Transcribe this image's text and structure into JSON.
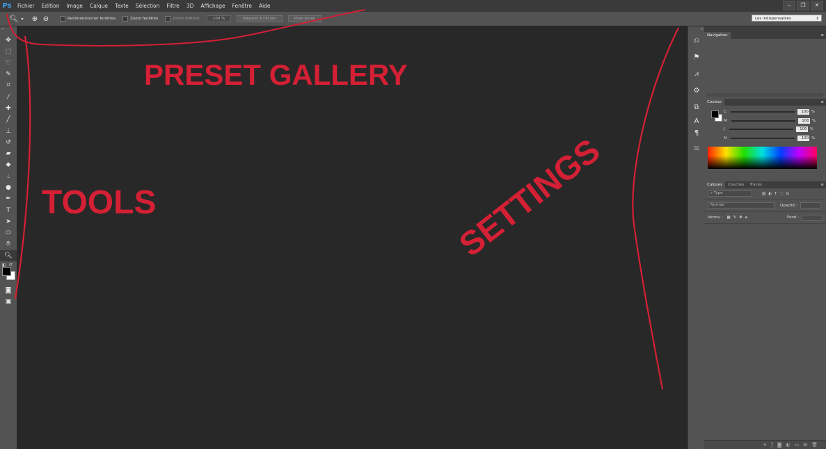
{
  "app": {
    "logo": "Ps"
  },
  "menu": [
    "Fichier",
    "Edition",
    "Image",
    "Calque",
    "Texte",
    "Sélection",
    "Filtre",
    "3D",
    "Affichage",
    "Fenêtre",
    "Aide"
  ],
  "window_controls": {
    "minimize": "‒",
    "restore": "❐",
    "close": "✕"
  },
  "options": {
    "resize_windows": "Redimensionner fenêtres",
    "zoom_all": "Zoom fenêtres",
    "scrubby_zoom": "Zoom défilant",
    "zoom_value": "100 %",
    "fit_screen": "Adapter à l'écran",
    "fill_screen": "Plein écran"
  },
  "workspace": "Les indispensables",
  "panels": {
    "navigation": {
      "title": "Navigation"
    },
    "color": {
      "title": "Couleur",
      "sliders": [
        {
          "label": "C",
          "value": "100",
          "unit": "%"
        },
        {
          "label": "M",
          "value": "100",
          "unit": "%"
        },
        {
          "label": "J",
          "value": "100",
          "unit": "%"
        },
        {
          "label": "N",
          "value": "100",
          "unit": "%"
        }
      ]
    },
    "layers": {
      "tabs": [
        "Calques",
        "Couches",
        "Tracés"
      ],
      "filter": "Type",
      "blend_mode": "Normal",
      "opacity_label": "Opacité :",
      "lock_label": "Verrou :",
      "fill_label": "Fond :"
    }
  },
  "annotations": {
    "top": "PRESET GALLERY",
    "left": "TOOLS",
    "right": "SETTINGS"
  },
  "colors": {
    "annotation": "#d42035",
    "ps_blue": "#3fa0f0"
  }
}
